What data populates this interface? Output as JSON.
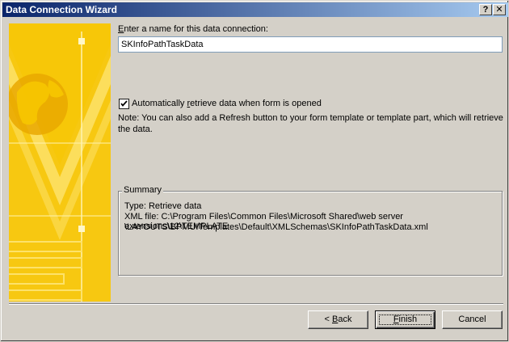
{
  "window": {
    "title": "Data Connection Wizard",
    "help_glyph": "?",
    "close_glyph": "✕"
  },
  "form": {
    "name_label_prefix": "",
    "name_label_accel": "E",
    "name_label_rest": "nter a name for this data connection:",
    "name_value": "SKInfoPathTaskData",
    "auto_checkbox_checked": true,
    "auto_label_prefix": "Automatically ",
    "auto_label_accel": "r",
    "auto_label_rest": "etrieve data when form is opened",
    "note_line1": "Note: You can also add a Refresh button to your form template or template part, which will retrieve",
    "note_line2": "the data."
  },
  "summary": {
    "legend": "Summary",
    "type_line": "Type: Retrieve data",
    "xml_line1": "XML file: C:\\Program Files\\Common Files\\Microsoft Shared\\web server extensions\\12\\TEMPLATE",
    "xml_line2": "\\LAYOUTS\\BPMUITemplates\\Default\\XMLSchemas\\SKInfoPathTaskData.xml"
  },
  "buttons": {
    "back_prefix": "< ",
    "back_accel": "B",
    "back_rest": "ack",
    "finish_accel": "F",
    "finish_rest": "inish",
    "cancel": "Cancel"
  },
  "colors": {
    "art_primary": "#f7c600",
    "art_light": "#fde26a",
    "art_dark": "#e9a800"
  }
}
